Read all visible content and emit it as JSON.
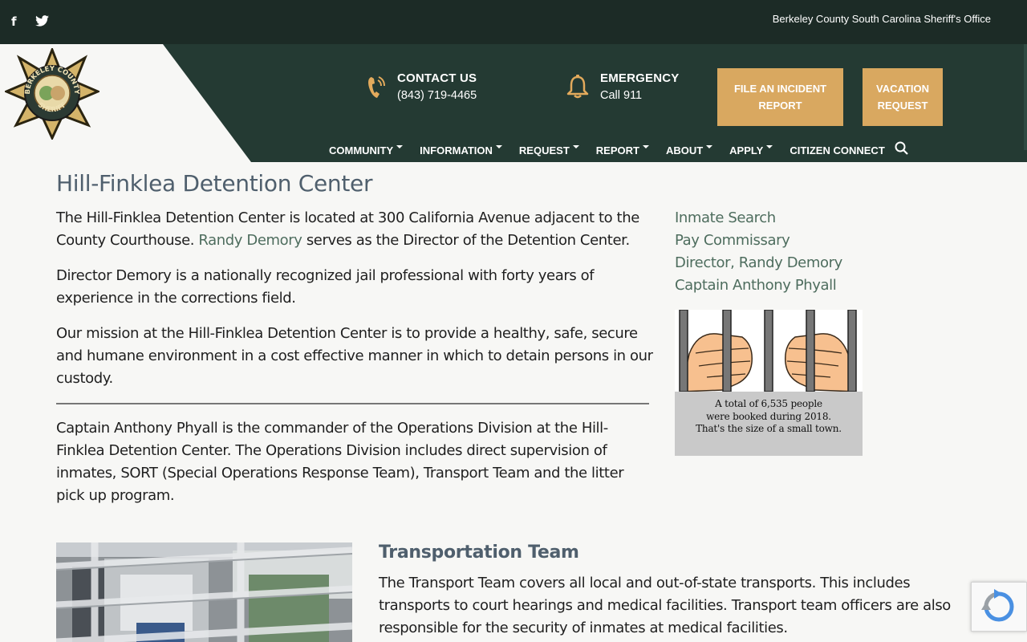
{
  "topbar": {
    "site_name": "Berkeley County South Carolina Sheriff's Office",
    "social": [
      {
        "icon": "facebook-icon",
        "glyph": "f"
      },
      {
        "icon": "twitter-icon"
      }
    ]
  },
  "header": {
    "logo": {
      "icon": "sheriff-badge-logo",
      "text_top": "BERKELEY COUNTY",
      "text_bottom": "SHERIFF"
    },
    "contact": {
      "icon": "phone-icon",
      "title": "CONTACT US",
      "detail": "(843) 719-4465"
    },
    "emergency": {
      "icon": "bell-icon",
      "title": "EMERGENCY",
      "detail": "Call 911"
    },
    "buttons": [
      {
        "label": "FILE AN INCIDENT\nREPORT"
      },
      {
        "label": "VACATION\nREQUEST"
      }
    ],
    "nav": [
      {
        "label": "COMMUNITY",
        "dropdown": true
      },
      {
        "label": "INFORMATION",
        "dropdown": true
      },
      {
        "label": "REQUEST",
        "dropdown": true
      },
      {
        "label": "REPORT",
        "dropdown": true
      },
      {
        "label": "ABOUT",
        "dropdown": true
      },
      {
        "label": "APPLY",
        "dropdown": true
      },
      {
        "label": "CITIZEN CONNECT",
        "dropdown": false
      }
    ],
    "search_icon": "search-icon"
  },
  "main": {
    "title": "Hill-Finklea Detention Center",
    "p1_before": "The Hill-Finklea Detention Center is located at 300 California Avenue adjacent to the County Courthouse. ",
    "p1_link": "Randy Demory",
    "p1_after": " serves as the Director of the Detention Center.",
    "p2": "Director Demory is a nationally recognized jail professional with forty years of experience in the corrections field.",
    "p3": "Our mission at the Hill-Finklea Detention Center is to provide a healthy, safe, secure and humane environment in a cost effective manner in which to detain persons in our custody.",
    "p4": "Captain Anthony Phyall is the commander of the Operations Division at the Hill-Finklea Detention Center. The Operations Division includes direct supervision of inmates, SORT (Special Operations Response Team), Transport Team and the litter pick up program."
  },
  "sidebar": {
    "links": [
      "Inmate Search",
      "Pay Commissary",
      "Director, Randy Demory",
      "Captain Anthony Phyall"
    ],
    "card_caption": [
      "A total of 6,535 people",
      "were booked during 2018.",
      "That's the size of a small town."
    ]
  },
  "transport": {
    "title": "Transportation Team",
    "text": "The Transport Team covers all local and out-of-state transports. This includes transports to court hearings and medical facilities. Transport team officers are also responsible for the security of inmates at medical facilities."
  },
  "colors": {
    "topbar": "#1c2b26",
    "header": "#243a33",
    "accent_button": "#d9a860",
    "link": "#4e6d5e",
    "heading": "#4f5f6d"
  }
}
